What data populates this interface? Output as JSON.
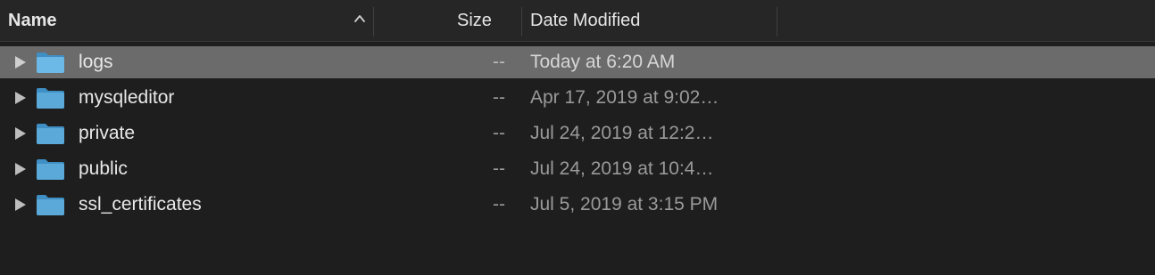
{
  "header": {
    "name_label": "Name",
    "size_label": "Size",
    "date_label": "Date Modified",
    "sort_indicator": "chevron-up-icon"
  },
  "colors": {
    "background": "#1e1e1e",
    "header_bg": "#262626",
    "selected_row": "#6b6b6b",
    "folder_blue": "#5aa9d8",
    "text_primary": "#e8e8e8",
    "text_secondary": "#9a9a9a"
  },
  "rows": [
    {
      "name": "logs",
      "size": "--",
      "date": "Today at 6:20 AM",
      "selected": true,
      "icon": "folder-icon"
    },
    {
      "name": "mysqleditor",
      "size": "--",
      "date": "Apr 17, 2019 at 9:02…",
      "selected": false,
      "icon": "folder-icon"
    },
    {
      "name": "private",
      "size": "--",
      "date": "Jul 24, 2019 at 12:2…",
      "selected": false,
      "icon": "folder-icon"
    },
    {
      "name": "public",
      "size": "--",
      "date": "Jul 24, 2019 at 10:4…",
      "selected": false,
      "icon": "folder-icon"
    },
    {
      "name": "ssl_certificates",
      "size": "--",
      "date": "Jul 5, 2019 at 3:15 PM",
      "selected": false,
      "icon": "folder-icon"
    }
  ]
}
